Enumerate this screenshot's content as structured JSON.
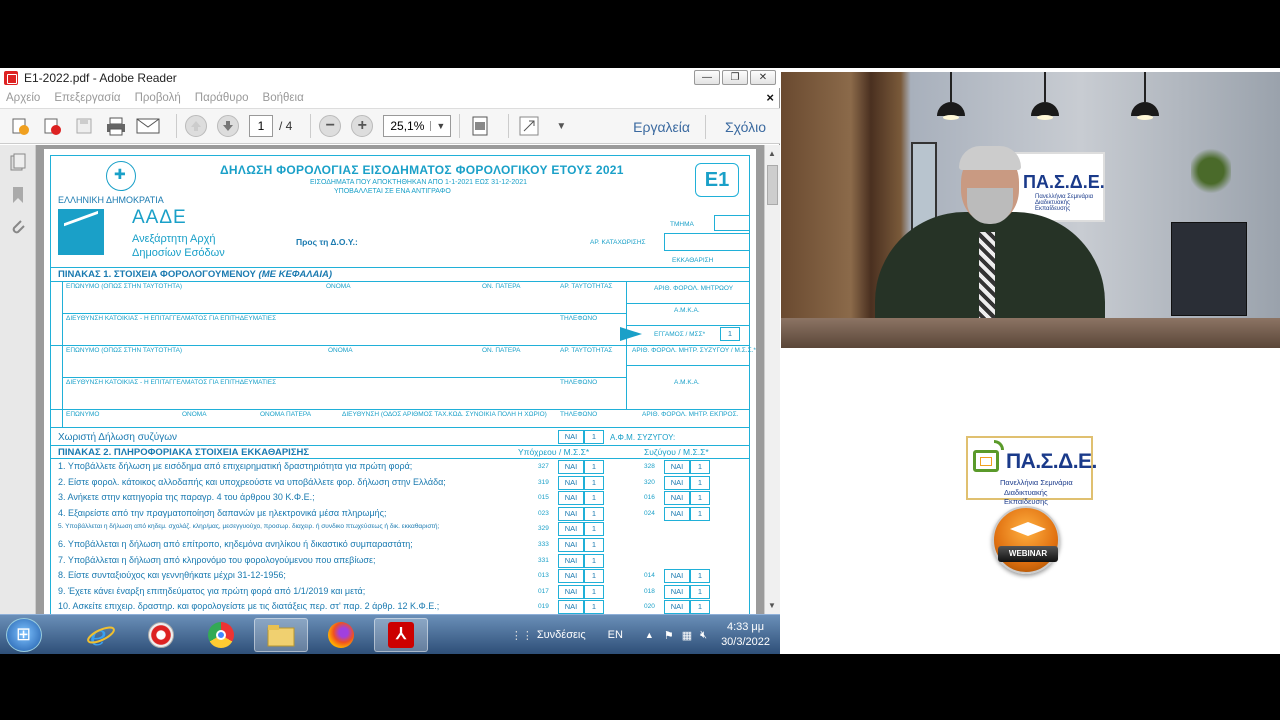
{
  "window": {
    "title": "E1-2022.pdf - Adobe Reader",
    "btn_min": "—",
    "btn_max": "❐",
    "btn_close": "✕"
  },
  "menu": {
    "items": [
      "Αρχείο",
      "Επεξεργασία",
      "Προβολή",
      "Παράθυρο",
      "Βοήθεια"
    ],
    "close_doc": "×"
  },
  "toolbar": {
    "page_current": "1",
    "page_total": "/ 4",
    "zoom": "25,1%",
    "tools_label": "Εργαλεία",
    "comment_label": "Σχόλιο"
  },
  "form": {
    "title": "ΔΗΛΩΣΗ ΦΟΡΟΛΟΓΙΑΣ ΕΙΣΟΔΗΜΑΤΟΣ ΦΟΡΟΛΟΓΙΚΟΥ ΕΤΟΥΣ 2021",
    "subtitle1": "ΕΙΣΟΔΗΜΑΤΑ ΠΟΥ ΑΠΟΚΤΗΘΗΚΑΝ ΑΠΟ 1-1-2021 ΕΩΣ 31-12-2021",
    "subtitle2": "ΥΠΟΒΑΛΛΕΤΑΙ ΣΕ ΕΝΑ ΑΝΤΙΓΡΑΦΟ",
    "form_code": "Ε1",
    "country": "ΕΛΛΗΝΙΚΗ ΔΗΜΟΚΡΑΤΙΑ",
    "agency": "ΑΑΔΕ",
    "agency_desc1": "Ανεξάρτητη Αρχή",
    "agency_desc2": "Δημοσίων Εσόδων",
    "to_doy": "Προς τη Δ.Ο.Υ.:",
    "tmima": "ΤΜΗΜΑ",
    "ar_kataxorisis": "ΑΡ. ΚΑΤΑΧΩΡΙΣΗΣ",
    "ekkathariseis": "ΕΚΚΑΘΑΡΙΣΗ",
    "table1_title": "ΠΙΝΑΚΑΣ 1. ΣΤΟΙΧΕΙΑ ΦΟΡΟΛΟΓΟΥΜΕΝΟΥ",
    "table1_note": "(ΜΕ ΚΕΦΑΛΑΙΑ)",
    "lbl_eponymo": "ΕΠΩΝΥΜΟ (ΟΠΩΣ ΣΤΗΝ ΤΑΥΤΟΤΗΤΑ)",
    "lbl_onoma": "ΟΝΟΜΑ",
    "lbl_patera": "ΟΝ. ΠΑΤΕΡΑ",
    "lbl_taytotita": "ΑΡ. ΤΑΥΤΟΤΗΤΑΣ",
    "lbl_afm_mitroo": "ΑΡΙΘ. ΦΟΡΟΛ. ΜΗΤΡΩΟΥ",
    "lbl_amka": "Α.Μ.Κ.Α.",
    "lbl_dieythynsi": "ΔΙΕΥΘΥΝΣΗ ΚΑΤΟΙΚΙΑΣ - Η ΕΠΙΤΑΓΓΕΛΜΑΤΟΣ ΓΙΑ ΕΠΙΤΗΔΕΥΜΑΤΙΕΣ",
    "lbl_tilefono": "ΤΗΛΕΦΩΝΟ",
    "lbl_eggamos": "ΕΓΓΑΜΟΣ / ΜΣΣ*",
    "eggamos_val": "1",
    "lbl_afm_syzygou": "ΑΡΙΘ. ΦΟΡΟΛ. ΜΗΤΡ. ΣΥΖΥΓΟΥ / Μ.Σ.Σ.*",
    "lbl_row3": "ΕΠΩΝΥΜΟ",
    "lbl_row3_onoma": "ΟΝΟΜΑ",
    "lbl_row3_patera": "ΟΝΟΜΑ ΠΑΤΕΡΑ",
    "lbl_row3_addr": "ΔΙΕΥΘΥΝΣΗ (ΟΔΟΣ ΑΡΙΘΜΟΣ ΤΑΧ.ΚΩΔ. ΣΥΝΟΙΚΙΑ ΠΟΛΗ Η ΧΩΡΙΟ)",
    "lbl_row3_afm": "ΑΡΙΘ. ΦΟΡΟΛ. ΜΗΤΡ. ΕΚΠΡΟΣ.",
    "separate": "Χωριστή Δήλωση συζύγων",
    "separate_nai": "ΝΑΙ",
    "separate_one": "1",
    "afm_syzygou": "Α.Φ.Μ. ΣΥΖΥΓΟΥ:",
    "table2_title": "ΠΙΝΑΚΑΣ 2. ΠΛΗΡΟΦΟΡΙΑΚΑ ΣΤΟΙΧΕΙΑ ΕΚΚΑΘΑΡΙΣΗΣ",
    "col_ypoxreou": "Υπόχρεου / Μ.Σ.Σ*",
    "col_syzygou": "Συζύγου / Μ.Σ.Σ*",
    "nai": "ΝΑΙ",
    "one": "1",
    "questions": [
      {
        "text": "1. Υποβάλλετε δήλωση με εισόδημα από επιχειρηματική δραστηριότητα για πρώτη φορά;",
        "code_a": "327",
        "code_b": "328"
      },
      {
        "text": "2. Είστε φορολ. κάτοικος αλλοδαπής και υποχρεούστε να υποβάλλετε φορ. δήλωση στην Ελλάδα;",
        "code_a": "319",
        "code_b": "320"
      },
      {
        "text": "3. Ανήκετε στην κατηγορία της παραγρ. 4 του άρθρου 30 Κ.Φ.Ε.;",
        "code_a": "015",
        "code_b": "016"
      },
      {
        "text": "4. Εξαιρείστε από την πραγματοποίηση δαπανών με ηλεκτρονικά μέσα πληρωμής;",
        "code_a": "023",
        "code_b": "024"
      },
      {
        "text": "5. Υποβάλλεται η δήλωση από κηδεμ. σχολάζ. κληρ/μας, μεσεγγυούχο, προσωρ. διαχειρ. ή συνδικο πτωχεύσεως ή δικ. εκκαθαριστή;",
        "code_a": "329",
        "code_b": ""
      },
      {
        "text": "6. Υποβάλλεται η δήλωση από επίτροπο, κηδεμόνα ανηλίκου ή δικαστικό συμπαραστάτη;",
        "code_a": "333",
        "code_b": ""
      },
      {
        "text": "7. Υποβάλλεται η δήλωση από κληρονόμο του φορολογούμενου που απεβίωσε;",
        "code_a": "331",
        "code_b": ""
      },
      {
        "text": "8. Είστε συνταξιούχος και γεννηθήκατε μέχρι 31-12-1956;",
        "code_a": "013",
        "code_b": "014"
      },
      {
        "text": "9. Έχετε κάνει έναρξη επιτηδεύματος για πρώτη φορά από 1/1/2019 και μετά;",
        "code_a": "017",
        "code_b": "018"
      },
      {
        "text": "10. Ασκείτε επιχειρ. δραστηρ. και φορολογείστε με τις διατάξεις  περ. στ' παρ. 2 άρθρ. 12  Κ.Φ.Ε.;",
        "code_a": "019",
        "code_b": "020"
      }
    ]
  },
  "taskbar": {
    "apps": [
      "internet-explorer",
      "recorder",
      "chrome",
      "file-explorer",
      "firefox",
      "adobe-reader"
    ],
    "links_label": "Συνδέσεις",
    "lang": "EN",
    "time": "4:33 μμ",
    "date": "30/3/2022"
  },
  "video": {
    "poster_title": "ΠΑ.Σ.Δ.Ε.",
    "poster_sub": "Πανελλήνια Σεμινάρια Διαδικτυακής Εκπαίδευσης"
  },
  "brand": {
    "name": "ΠΑ.Σ.Δ.Ε.",
    "sub1": "Πανελλήνια Σεμινάρια",
    "sub2": "Διαδικτυακής Εκπαίδευσης",
    "webinar": "WEBINAR"
  }
}
